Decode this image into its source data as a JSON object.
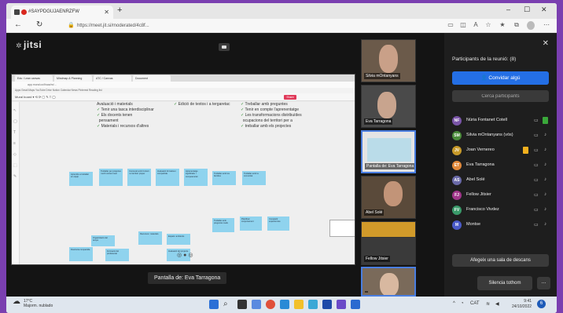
{
  "browser": {
    "tab_title": "#SAYPDGUJAENRZFW",
    "new_tab": "+",
    "url": "https://meet.jit.si/moderated/4c8f...",
    "win_min": "–",
    "win_max": "☐",
    "win_close": "✕"
  },
  "app": {
    "logo": "jitsi"
  },
  "shared_screen": {
    "tabs": [
      "Edu / Lean canvas",
      "Mindmap & Planning",
      "ATC / Canvas",
      "Document"
    ],
    "url": "app.mural.co/t/saa/m/...",
    "bookmarks": "Apps  Gmail  Maps  YouTube  Drive  Notion  Calendar  News  Pinterest  Reading list",
    "toolbar": "Mural board ▾    ⟲  ⟳    ▢  ✎  T  ◯",
    "share_label": "Share",
    "notes_left": [
      "Avaluació i materials",
      "Tenir una tasca interdisciplinar",
      "Els docents tenen",
      "pensament",
      "Materials i recursos d'altres"
    ],
    "notes_mid": [
      "Edició de textos i a tergaretac"
    ],
    "notes_right": [
      "Treballar amb preguntes",
      "Tenir en compte l'aprenentatge",
      "Les transformacions distribuïdes",
      "ocupacions del territori per a",
      "treballar amb els projectes"
    ],
    "stickies_row1": [
      "Aprendre a treballar en equip",
      "Treballar per projectes i amb context real",
      "Connexió amb l'entorn i el territori proper",
      "Avaluació formativa i compartida",
      "Aprenentatge significatiu i competencial",
      "Treballar amb les famílies",
      "Treballar amb la comunitat"
    ],
    "stickies_row2": [
      "Treballar amb preguntes reals",
      "Planificar conjuntament",
      "Compartir experiències"
    ],
    "stickies_row3": [
      "Organització del temps",
      "Recursos i materials",
      "Espais i ambients",
      "Docència compartida",
      "Formació del professorat",
      "Avaluació del projecte"
    ],
    "caption": "Pantalla de: Eva Tarragona"
  },
  "videos": [
    {
      "label": "Silvia mOntanyans"
    },
    {
      "label": "Eva Tarragona"
    },
    {
      "label": "Pantalla de: Eva Tarragona"
    },
    {
      "label": "Abel Solé"
    },
    {
      "label": ""
    },
    {
      "label": "Fellow Jitsier"
    },
    {
      "label": ""
    }
  ],
  "panel": {
    "title": "Participants de la reunió: (8)",
    "invite_label": "Convidar algú",
    "search_placeholder": "Cerca participants",
    "participants": [
      {
        "initials": "NF",
        "name": "Núria Fontanet Cotell",
        "color": "#7a55a8"
      },
      {
        "initials": "SM",
        "name": "Silvia mOntanyans (vós)",
        "color": "#4a8a3a"
      },
      {
        "initials": "JV",
        "name": "Joan Vernereo",
        "color": "#c79a2a"
      },
      {
        "initials": "ET",
        "name": "Eva Tarragona",
        "color": "#e0883a"
      },
      {
        "initials": "AS",
        "name": "Abel Solé",
        "color": "#6a6aa8"
      },
      {
        "initials": "FJ",
        "name": "Fellow Jitsier",
        "color": "#a0368a"
      },
      {
        "initials": "FV",
        "name": "Francisco Vivdez",
        "color": "#3a9a6a"
      },
      {
        "initials": "M",
        "name": "Montse",
        "color": "#4a5ac8"
      }
    ],
    "breakout_label": "Afegeix una sala de descans",
    "mute_all_label": "Silencia tothom",
    "more_label": "..."
  },
  "taskbar": {
    "weather_temp": "17°C",
    "weather_desc": "Majorm. nublado",
    "tray_text": "CAT",
    "clock_time": "9:41",
    "clock_date": "24/10/2022",
    "notif_count": "6"
  },
  "colors": {
    "accent_blue": "#246fe5",
    "sticky_blue": "#8fd3ee",
    "share_button": "#e03a5a"
  }
}
